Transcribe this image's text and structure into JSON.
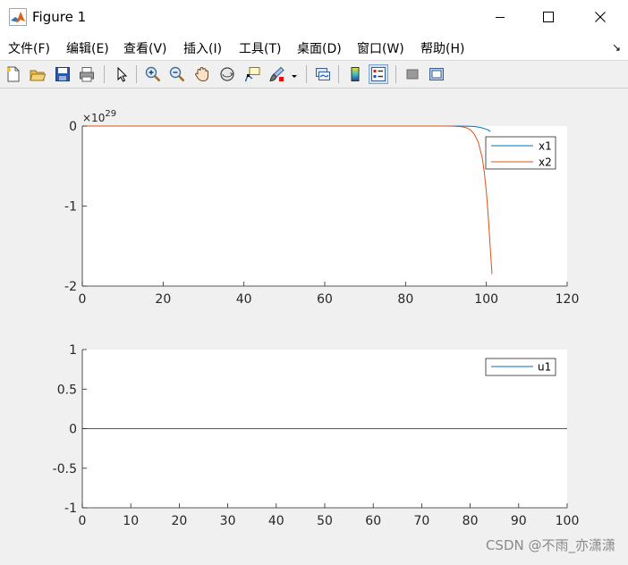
{
  "window": {
    "title": "Figure 1",
    "controls": {
      "minimize": "minimize",
      "maximize": "maximize",
      "close": "close"
    }
  },
  "menubar": {
    "items": [
      {
        "label": "文件(F)"
      },
      {
        "label": "编辑(E)"
      },
      {
        "label": "查看(V)"
      },
      {
        "label": "插入(I)"
      },
      {
        "label": "工具(T)"
      },
      {
        "label": "桌面(D)"
      },
      {
        "label": "窗口(W)"
      },
      {
        "label": "帮助(H)"
      }
    ],
    "dock_arrow": "↘"
  },
  "toolbar": {
    "icons": [
      "new-figure-icon",
      "open-file-icon",
      "save-icon",
      "print-icon",
      "edit-plot-arrow-icon",
      "zoom-in-icon",
      "zoom-out-icon",
      "pan-hand-icon",
      "rotate-3d-icon",
      "data-cursor-icon",
      "brush-icon",
      "brush-dropdown-icon",
      "link-plot-icon",
      "insert-colorbar-icon",
      "insert-legend-icon",
      "hide-plot-tools-icon",
      "show-plot-tools-icon"
    ]
  },
  "colors": {
    "series1": "#0072bd",
    "series2": "#d95319",
    "axes_bg": "#ffffff",
    "figure_bg": "#f0f0f0",
    "axis": "#262626"
  },
  "chart_data": [
    {
      "type": "line",
      "exponent_label": "×10",
      "exponent_power": "29",
      "xlim": [
        0,
        120
      ],
      "ylim": [
        -2,
        0
      ],
      "xticks": [
        0,
        20,
        40,
        60,
        80,
        100,
        120
      ],
      "yticks": [
        0,
        -1,
        -2
      ],
      "xtick_labels": [
        "0",
        "20",
        "40",
        "60",
        "80",
        "100",
        "120"
      ],
      "ytick_labels": [
        "0",
        "-1",
        "-2"
      ],
      "legend_position": "top-right",
      "series": [
        {
          "name": "x1",
          "color": "#0072bd",
          "x": [
            0,
            90,
            92,
            94,
            95,
            96,
            97,
            98,
            99,
            100,
            100.5,
            101
          ],
          "y": [
            0,
            0,
            -0.0002,
            -0.0008,
            -0.0015,
            -0.003,
            -0.006,
            -0.012,
            -0.024,
            -0.04,
            -0.05,
            -0.07
          ]
        },
        {
          "name": "x2",
          "color": "#d95319",
          "x": [
            0,
            88,
            90,
            92,
            94,
            95,
            96,
            97,
            98,
            99,
            99.5,
            100,
            100.5,
            101,
            101.4
          ],
          "y": [
            0,
            0,
            -0.0005,
            -0.002,
            -0.008,
            -0.02,
            -0.045,
            -0.1,
            -0.2,
            -0.4,
            -0.58,
            -0.82,
            -1.15,
            -1.55,
            -1.85
          ]
        }
      ]
    },
    {
      "type": "line",
      "xlim": [
        0,
        100
      ],
      "ylim": [
        -1,
        1
      ],
      "xticks": [
        0,
        10,
        20,
        30,
        40,
        50,
        60,
        70,
        80,
        90,
        100
      ],
      "yticks": [
        1,
        0.5,
        0,
        -0.5,
        -1
      ],
      "xtick_labels": [
        "0",
        "10",
        "20",
        "30",
        "40",
        "50",
        "60",
        "70",
        "80",
        "90",
        "100"
      ],
      "ytick_labels": [
        "1",
        "0.5",
        "0",
        "-0.5",
        "-1"
      ],
      "legend_position": "top-right",
      "series": [
        {
          "name": "u1",
          "color": "#0072bd",
          "x": [
            0,
            100
          ],
          "y": [
            0,
            0
          ]
        }
      ]
    }
  ],
  "watermark": "CSDN @不雨_亦潇潇"
}
